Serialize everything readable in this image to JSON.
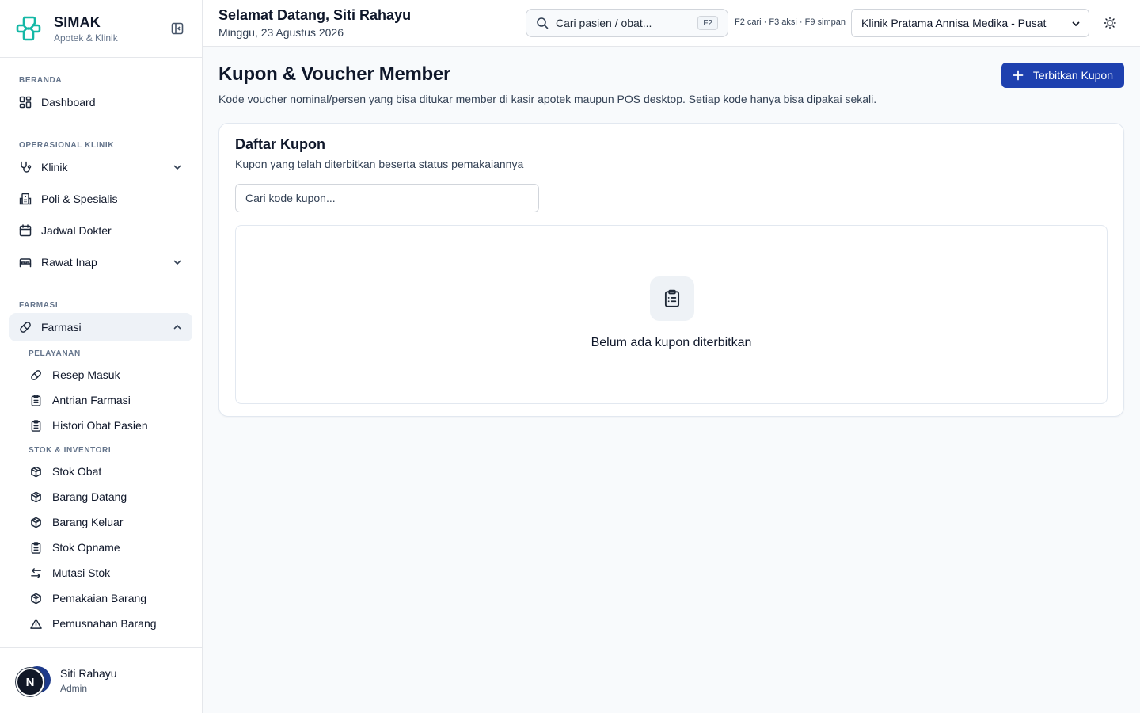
{
  "brand": {
    "name": "SIMAK",
    "subtitle": "Apotek & Klinik"
  },
  "sidebar": {
    "sections": {
      "beranda": "BERANDA",
      "operasional": "OPERASIONAL KLINIK",
      "farmasi": "FARMASI"
    },
    "items": {
      "dashboard": "Dashboard",
      "klinik": "Klinik",
      "poli": "Poli & Spesialis",
      "jadwal": "Jadwal Dokter",
      "rawat_inap": "Rawat Inap",
      "farmasi": "Farmasi"
    },
    "sublabels": {
      "pelayanan": "PELAYANAN",
      "stok": "STOK & INVENTORI"
    },
    "subitems": {
      "resep": "Resep Masuk",
      "antrian": "Antrian Farmasi",
      "histori": "Histori Obat Pasien",
      "stok_obat": "Stok Obat",
      "barang_datang": "Barang Datang",
      "barang_keluar": "Barang Keluar",
      "stok_opname": "Stok Opname",
      "mutasi": "Mutasi Stok",
      "pemakaian": "Pemakaian Barang",
      "pemusnahan": "Pemusnahan Barang"
    }
  },
  "user": {
    "initial": "N",
    "name": "Siti Rahayu",
    "role": "Admin"
  },
  "header": {
    "greeting": "Selamat Datang, Siti Rahayu",
    "date": "Minggu, 23 Agustus 2026",
    "search_placeholder": "Cari pasien / obat...",
    "search_kbd": "F2",
    "shortcuts": "F2 cari · F3 aksi · F9 simpan",
    "clinic": "Klinik Pratama Annisa Medika - Pusat"
  },
  "page": {
    "title": "Kupon & Voucher Member",
    "description": "Kode voucher nominal/persen yang bisa ditukar member di kasir apotek maupun POS desktop. Setiap kode hanya bisa dipakai sekali.",
    "primary_action": "Terbitkan Kupon"
  },
  "card": {
    "title": "Daftar Kupon",
    "subtitle": "Kupon yang telah diterbitkan beserta status pemakaiannya",
    "search_placeholder": "Cari kode kupon...",
    "empty_text": "Belum ada kupon diterbitkan"
  },
  "colors": {
    "primary": "#1e40af",
    "brand_logo": "#14b8a6",
    "active_bg": "#eef2f7"
  }
}
